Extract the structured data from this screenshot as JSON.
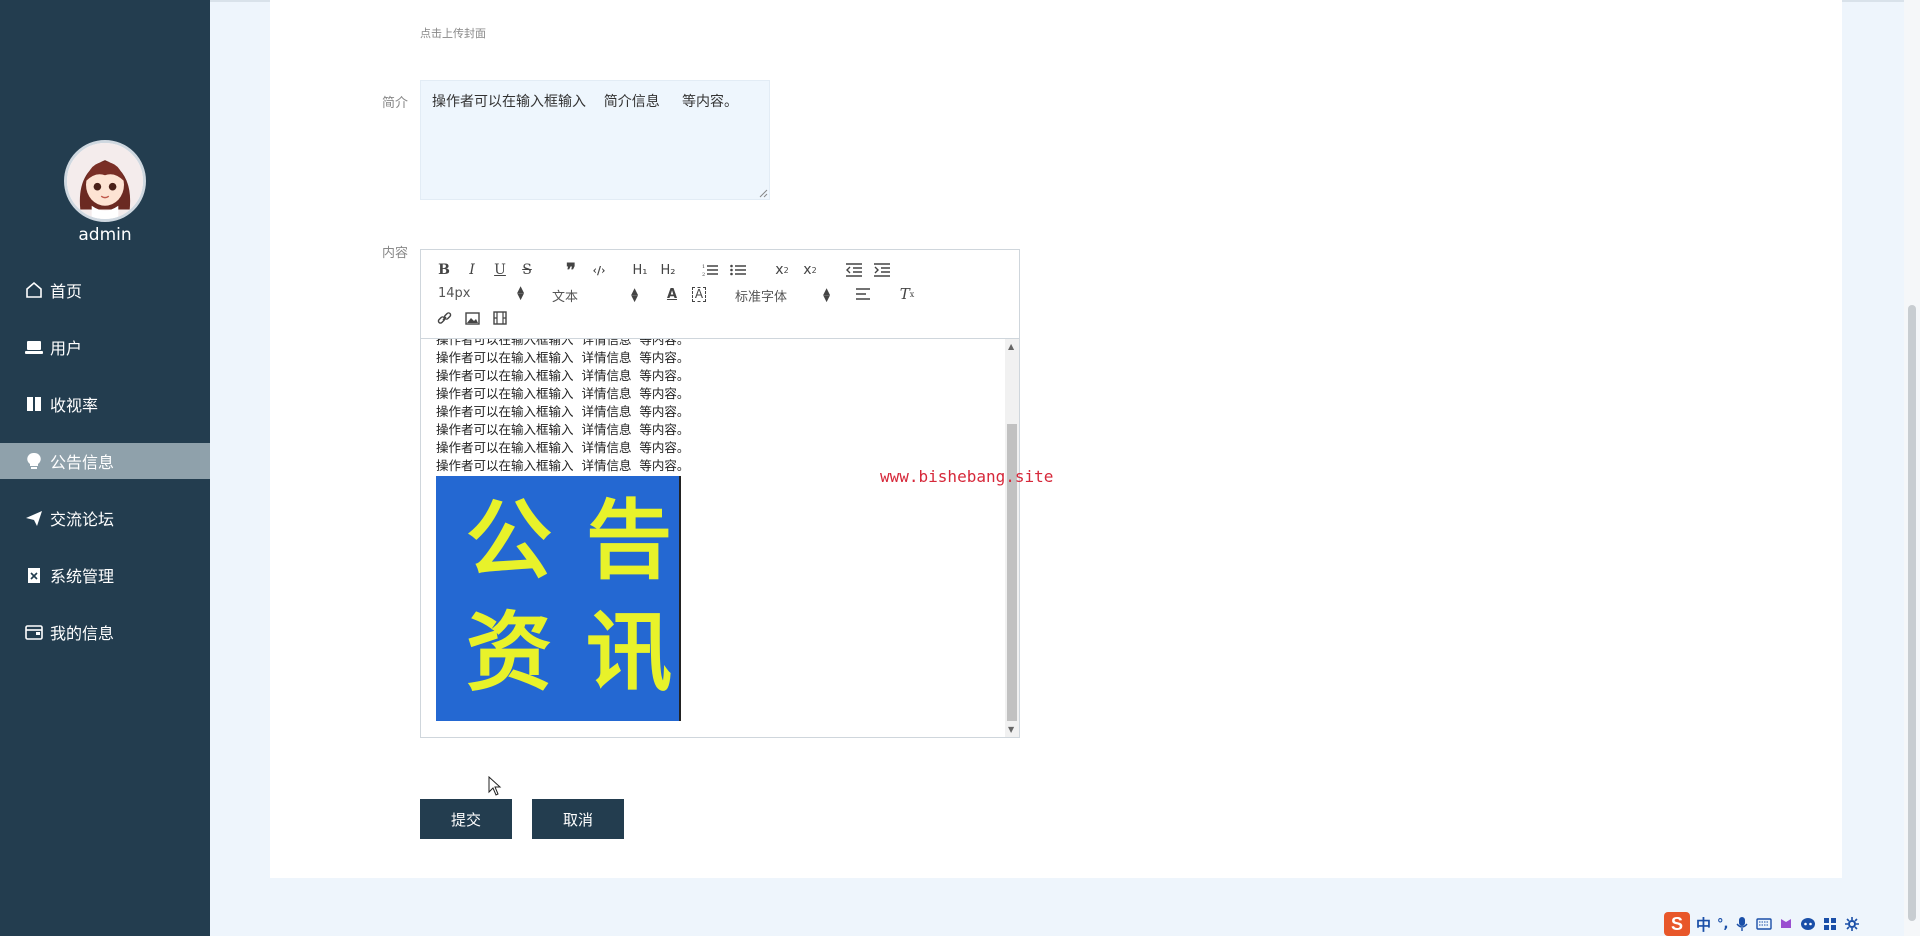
{
  "user": {
    "name": "admin"
  },
  "sidebar": {
    "items": [
      {
        "label": "首页",
        "icon": "home-icon"
      },
      {
        "label": "用户",
        "icon": "laptop-icon"
      },
      {
        "label": "收视率",
        "icon": "book-icon"
      },
      {
        "label": "公告信息",
        "icon": "bulb-icon",
        "active": true
      },
      {
        "label": "交流论坛",
        "icon": "send-icon"
      },
      {
        "label": "系统管理",
        "icon": "clipboard-icon"
      },
      {
        "label": "我的信息",
        "icon": "wallet-icon"
      }
    ]
  },
  "form": {
    "cover_hint": "点击上传封面",
    "intro_label": "简介",
    "intro_value": "操作者可以在输入框输入    简介信息     等内容。",
    "content_label": "内容",
    "submit_label": "提交",
    "cancel_label": "取消"
  },
  "editor": {
    "font_size": "14px",
    "header_select": "文本",
    "font_family": "标准字体",
    "lines": [
      "操作者可以在输入框输入  详情信息  等内容。",
      "操作者可以在输入框输入  详情信息  等内容。",
      "操作者可以在输入框输入  详情信息  等内容。",
      "操作者可以在输入框输入  详情信息  等内容。",
      "操作者可以在输入框输入  详情信息  等内容。",
      "操作者可以在输入框输入  详情信息  等内容。",
      "操作者可以在输入框输入  详情信息  等内容。",
      "操作者可以在输入框输入  详情信息  等内容。"
    ],
    "image_chars": [
      "公",
      "告",
      "资",
      "讯"
    ]
  },
  "watermark": "www.bishebang.site",
  "ime": {
    "lang": "中",
    "symbols": "°,"
  }
}
